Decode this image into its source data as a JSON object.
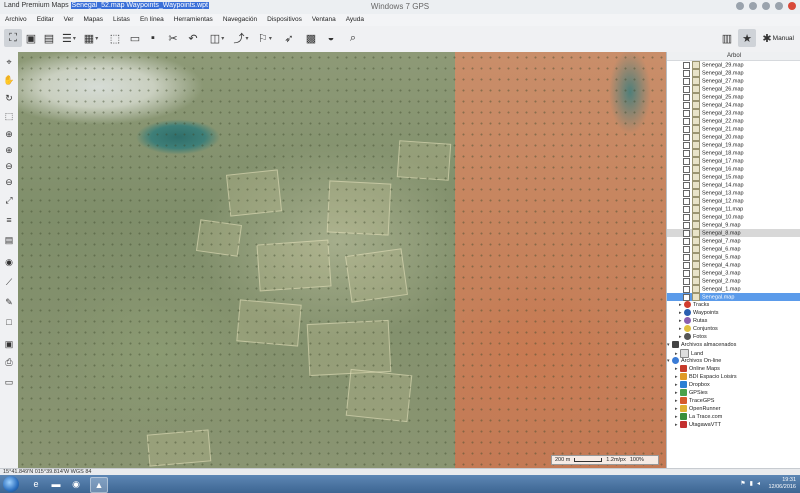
{
  "window": {
    "document_title_prefix": "Land Premium Maps",
    "document_title_highlight": "Senegal_52.map Waypoints_Waypoints.wpt",
    "app_title": "Windows 7 GPS"
  },
  "menu": [
    "Archivo",
    "Editar",
    "Ver",
    "Mapas",
    "Listas",
    "En línea",
    "Herramientas",
    "Navegación",
    "Dispositivos",
    "Ventana",
    "Ayuda"
  ],
  "toolbar": {
    "manual_label": "Manual",
    "icons": [
      "cursor-icon",
      "image-icon",
      "clipboard-icon",
      "list-icon",
      "grid-icon",
      "frame-icon",
      "folder-icon",
      "save-icon",
      "tools-icon",
      "undo-icon",
      "map-icon",
      "route-icon",
      "waypoint-icon",
      "navigate-icon",
      "qr-icon",
      "globe-icon",
      "search-icon",
      "lock-icon",
      "star-icon",
      "gear-icon"
    ]
  },
  "left_tools": [
    "pointer-icon",
    "hand-icon",
    "rotate-icon",
    "zoom-box-icon",
    "zoom-in-icon",
    "zoom-in-alt-icon",
    "zoom-out-icon",
    "zoom-out-alt-icon",
    "zoom-fit-icon",
    "layers-icon",
    "clipboard-icon",
    "gps-icon",
    "ruler-icon",
    "pencil-icon",
    "square-icon",
    "camera-icon",
    "printer-icon",
    "monitor-icon"
  ],
  "map": {
    "scale_text": "200 m",
    "speed_text": "1.2m/px",
    "zoom_text": "100%"
  },
  "panel": {
    "title": "Árbol",
    "maps": [
      "Senegal_29.map",
      "Senegal_28.map",
      "Senegal_27.map",
      "Senegal_26.map",
      "Senegal_25.map",
      "Senegal_24.map",
      "Senegal_23.map",
      "Senegal_22.map",
      "Senegal_21.map",
      "Senegal_20.map",
      "Senegal_19.map",
      "Senegal_18.map",
      "Senegal_17.map",
      "Senegal_16.map",
      "Senegal_15.map",
      "Senegal_14.map",
      "Senegal_13.map",
      "Senegal_12.map",
      "Senegal_11.map",
      "Senegal_10.map",
      "Senegal_9.map",
      "Senegal_8.map",
      "Senegal_7.map",
      "Senegal_6.map",
      "Senegal_5.map",
      "Senegal_4.map",
      "Senegal_3.map",
      "Senegal_2.map",
      "Senegal_1.map",
      "Senegal.map"
    ],
    "layers": [
      {
        "label": "Tracks",
        "color": "#d23c2e"
      },
      {
        "label": "Waypoints",
        "color": "#2a5fb0"
      },
      {
        "label": "Rutas",
        "color": "#8a5fb0"
      },
      {
        "label": "Conjuntos",
        "color": "#e0c040"
      },
      {
        "label": "Fotos",
        "color": "#555555"
      }
    ],
    "stored_files": "Archivos almacenados",
    "stored_land": "Land",
    "online_files": "Archivos On-line",
    "online_items": [
      {
        "label": "Online Maps",
        "color": "#c63b2b"
      },
      {
        "label": "BDI Espacio Loisirs",
        "color": "#e09a28"
      },
      {
        "label": "Dropbox",
        "color": "#2a7fd4"
      },
      {
        "label": "GPSies",
        "color": "#4aa14a"
      },
      {
        "label": "TraceGPS",
        "color": "#d65a2a"
      },
      {
        "label": "OpenRunner",
        "color": "#e0b030"
      },
      {
        "label": "La Trace.com",
        "color": "#3a8f3a"
      },
      {
        "label": "UtagawaVTT",
        "color": "#c43030"
      }
    ]
  },
  "status": {
    "coords": "15°41.849'N 015°39.814'W  WGS 84"
  },
  "taskbar": {
    "clock_time": "19:31",
    "clock_date": "12/06/2016"
  }
}
